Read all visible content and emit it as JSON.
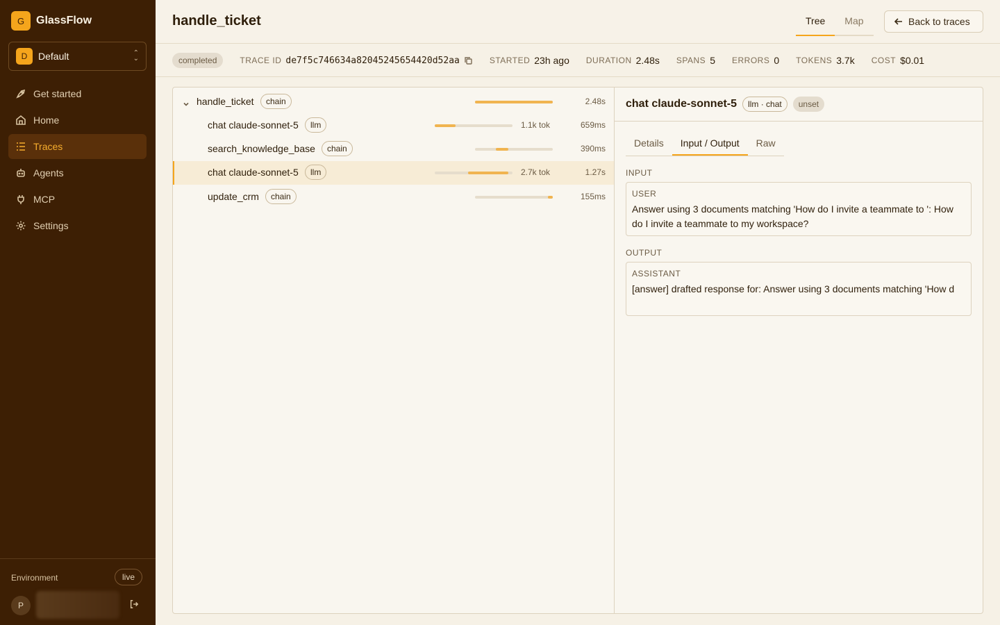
{
  "app": {
    "logo_letter": "G",
    "name": "GlassFlow"
  },
  "workspace": {
    "avatar_letter": "D",
    "name": "Default"
  },
  "nav": [
    {
      "label": "Get started",
      "icon": "rocket-icon"
    },
    {
      "label": "Home",
      "icon": "home-icon"
    },
    {
      "label": "Traces",
      "icon": "list-icon",
      "active": true
    },
    {
      "label": "Agents",
      "icon": "robot-icon"
    },
    {
      "label": "MCP",
      "icon": "plug-icon"
    },
    {
      "label": "Settings",
      "icon": "gear-icon"
    }
  ],
  "environment": {
    "label": "Environment",
    "badge": "live"
  },
  "user": {
    "avatar_letter": "P"
  },
  "header": {
    "title": "handle_ticket",
    "tabs": [
      "Tree",
      "Map"
    ],
    "active_tab": "Tree",
    "back_label": "Back to traces"
  },
  "meta": {
    "status": "completed",
    "trace_id_label": "TRACE ID",
    "trace_id": "de7f5c746634a82045245654420d52aa",
    "started_label": "STARTED",
    "started": "23h ago",
    "duration_label": "DURATION",
    "duration": "2.48s",
    "spans_label": "SPANS",
    "spans": "5",
    "errors_label": "ERRORS",
    "errors": "0",
    "tokens_label": "TOKENS",
    "tokens": "3.7k",
    "cost_label": "COST",
    "cost": "$0.01"
  },
  "spans": [
    {
      "name": "handle_ticket",
      "kind": "chain",
      "tokens": "",
      "duration": "2.48s",
      "start": 0.0,
      "end": 1.0,
      "depth": 0
    },
    {
      "name": "chat claude-sonnet-5",
      "kind": "llm",
      "tokens": "1.1k tok",
      "duration": "659ms",
      "start": 0.0,
      "end": 0.27,
      "depth": 1
    },
    {
      "name": "search_knowledge_base",
      "kind": "chain",
      "tokens": "",
      "duration": "390ms",
      "start": 0.27,
      "end": 0.43,
      "depth": 1
    },
    {
      "name": "chat claude-sonnet-5",
      "kind": "llm",
      "tokens": "2.7k tok",
      "duration": "1.27s",
      "start": 0.43,
      "end": 0.95,
      "depth": 1,
      "selected": true
    },
    {
      "name": "update_crm",
      "kind": "chain",
      "tokens": "",
      "duration": "155ms",
      "start": 0.94,
      "end": 1.0,
      "depth": 1
    }
  ],
  "detail": {
    "title": "chat claude-sonnet-5",
    "kind_badge": "llm · chat",
    "status_badge": "unset",
    "tabs": [
      "Details",
      "Input / Output",
      "Raw"
    ],
    "active_tab": "Input / Output",
    "input_label": "INPUT",
    "input_role": "USER",
    "input_text": "Answer using 3 documents matching 'How do I invite a teammate to ': How do I invite a teammate to my workspace?",
    "output_label": "OUTPUT",
    "output_role": "ASSISTANT",
    "output_text": "[answer] drafted response for: Answer using 3 documents matching 'How d"
  },
  "colors": {
    "accent": "#f5a51c",
    "sidebar_bg": "#3d1f04",
    "bar_fill": "#f0b450"
  }
}
